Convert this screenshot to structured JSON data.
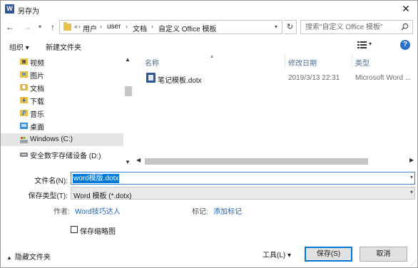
{
  "window": {
    "title": "另存为",
    "app_icon_letter": "W",
    "close_glyph": "✕"
  },
  "address": {
    "overflow": "«",
    "crumbs": [
      "用户",
      "user",
      "文档",
      "自定义 Office 模板"
    ],
    "separator": "›",
    "search_placeholder": "搜索\"自定义 Office 模板\""
  },
  "toolbar": {
    "organize": "组织 ▾",
    "new_folder": "新建文件夹"
  },
  "nav": {
    "items": [
      {
        "label": "视频",
        "icon": "video-folder-icon"
      },
      {
        "label": "图片",
        "icon": "pictures-folder-icon"
      },
      {
        "label": "文档",
        "icon": "documents-folder-icon"
      },
      {
        "label": "下载",
        "icon": "downloads-folder-icon"
      },
      {
        "label": "音乐",
        "icon": "music-folder-icon"
      },
      {
        "label": "桌面",
        "icon": "desktop-folder-icon"
      },
      {
        "label": "Windows (C:)",
        "icon": "drive-c-icon",
        "selected": true
      },
      {
        "label": "安全数字存储设备 (D:)",
        "icon": "drive-d-icon"
      }
    ]
  },
  "filelist": {
    "columns": {
      "name": "名称",
      "date": "修改日期",
      "type": "类型"
    },
    "files": [
      {
        "name": "笔记模板.dotx",
        "date": "2019/3/13 22:31",
        "type": "Microsoft Word ..."
      }
    ]
  },
  "form": {
    "filename_label": "文件名(N):",
    "filename_value": "word模版.dotx",
    "savetype_label": "保存类型(T):",
    "savetype_value": "Word 模板 (*.dotx)",
    "author_label": "作者:",
    "author_value": "Word技巧达人",
    "tags_label": "标记:",
    "tags_value": "添加标记",
    "thumbnail_label": "保存缩略图",
    "thumbnail_checked": false
  },
  "footer": {
    "hide_folders": "隐藏文件夹",
    "tools": "工具(L)  ▾",
    "save": "保存(S)",
    "cancel": "取消"
  },
  "colors": {
    "accent": "#0078d7",
    "link": "#1a62b8",
    "word_blue": "#2b579a"
  }
}
